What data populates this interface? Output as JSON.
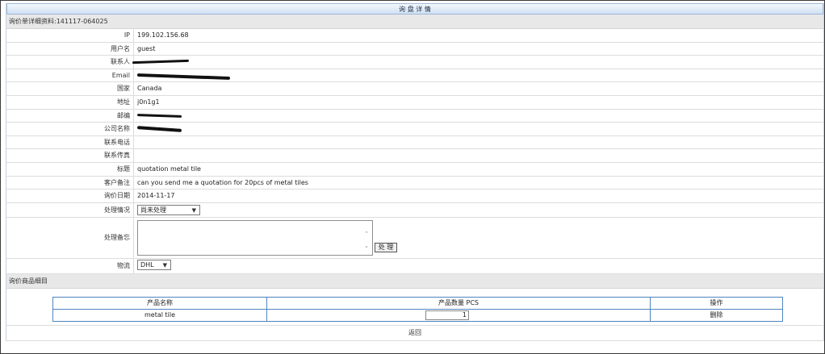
{
  "header": {
    "title": "询 盘 详 情"
  },
  "inquiry_section": {
    "label": "询价单详细资料:141117-064025"
  },
  "fields": [
    {
      "label": "IP",
      "value": "199.102.156.68"
    },
    {
      "label": "用户名",
      "value": "guest"
    },
    {
      "label": "联系人",
      "value": ""
    },
    {
      "label": "Email",
      "value": ""
    },
    {
      "label": "国家",
      "value": "Canada"
    },
    {
      "label": "地址",
      "value": "j0n1g1"
    },
    {
      "label": "邮编",
      "value": ""
    },
    {
      "label": "公司名称",
      "value": ""
    },
    {
      "label": "联系电话",
      "value": ""
    },
    {
      "label": "联系传真",
      "value": ""
    },
    {
      "label": "标题",
      "value": "quotation metal tile"
    },
    {
      "label": "客户备注",
      "value": "can you send me a quotation for 20pcs of metal tiles"
    },
    {
      "label": "询价日期",
      "value": "2014-11-17"
    }
  ],
  "status": {
    "label": "处理情况",
    "selected": "尚未处理"
  },
  "note": {
    "label": "处理备忘",
    "value": "",
    "submit_label": "处 理"
  },
  "shipping": {
    "label": "物流",
    "selected": "DHL"
  },
  "goods_section": {
    "label": "询价商品细目"
  },
  "goods_table": {
    "headers": [
      "产品名称",
      "产品数量 PCS",
      "操作"
    ],
    "rows": [
      {
        "name": "metal tile",
        "quantity": "1",
        "action": "删除"
      }
    ]
  },
  "footer": {
    "back_label": "返回"
  },
  "colors": {
    "title_bar": "#cfe0f3",
    "table_border": "#4f85bf",
    "section_bg": "#e8e8e8"
  },
  "icons": {
    "dropdown": "chevron-down-icon",
    "scroll_up": "chevron-up-icon",
    "scroll_down": "chevron-down-icon"
  }
}
